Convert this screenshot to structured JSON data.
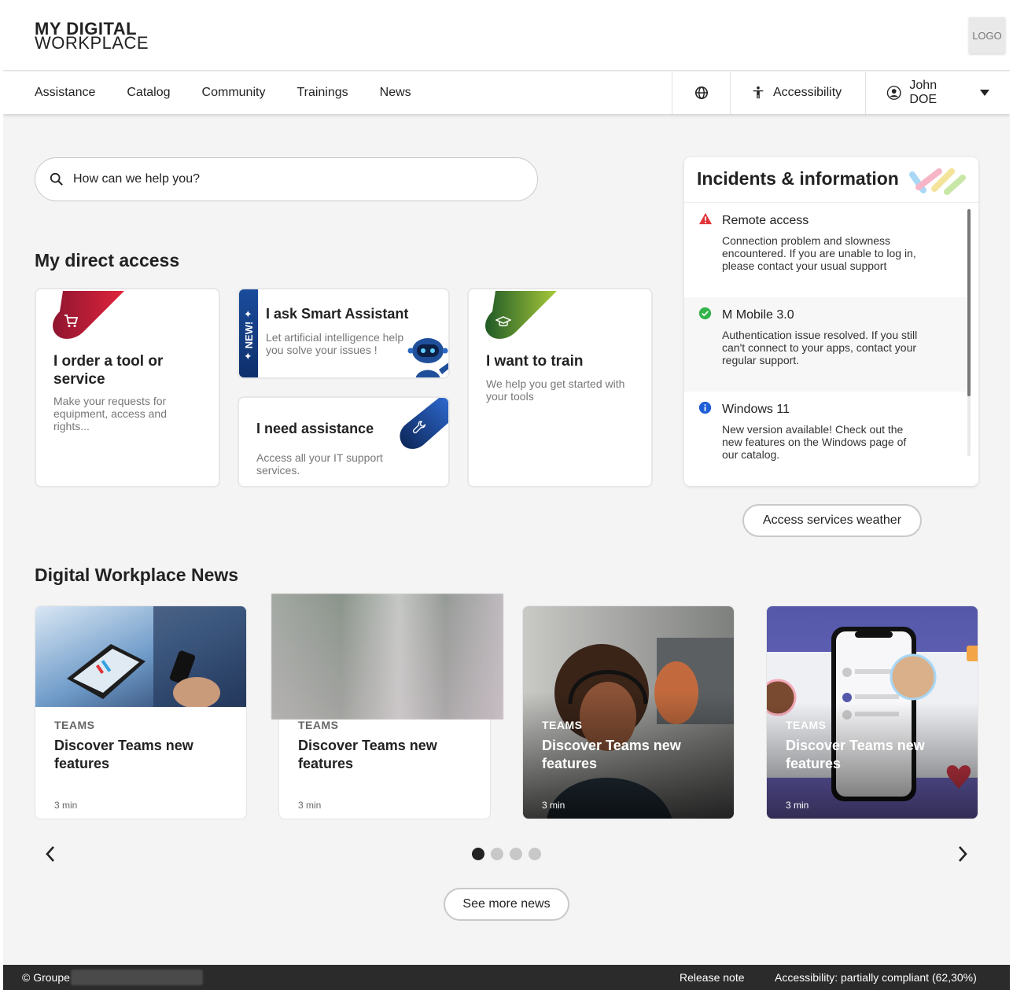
{
  "header": {
    "brand_line1": "MY DIGITAL",
    "brand_line2": "WORKPLACE",
    "logo_label": "LOGO"
  },
  "nav": {
    "items": [
      "Assistance",
      "Catalog",
      "Community",
      "Trainings",
      "News"
    ],
    "globe_icon": "globe-icon",
    "accessibility_label": "Accessibility",
    "user_name": "John DOE"
  },
  "search": {
    "placeholder": "How can we help you?"
  },
  "direct_access": {
    "title": "My direct access",
    "cards": [
      {
        "title": "I order a tool or service",
        "desc": "Make your requests for equipment, access and rights...",
        "icon": "cart-icon",
        "color": "#b01c35"
      },
      {
        "title": "I ask Smart Assistant",
        "desc": "Let artificial intelligence help you solve your issues !",
        "badge": "NEW!",
        "icon": "robot-icon"
      },
      {
        "title": "I need assistance",
        "desc": "Access all your IT support services.",
        "icon": "wrench-icon",
        "color": "#123a7a"
      },
      {
        "title": "I want to train",
        "desc": "We help you get started with your tools",
        "icon": "graduation-cap-icon",
        "color": "#2f6b2a"
      }
    ]
  },
  "incidents": {
    "title": "Incidents & information",
    "items": [
      {
        "title": "Remote access",
        "desc": "Connection problem and slowness encountered. If you are unable to log in, please contact your usual support",
        "status": "warning",
        "color": "#e0343a"
      },
      {
        "title": "M Mobile 3.0",
        "desc": "Authentication issue resolved. If you still can't connect to your apps, contact your regular support.",
        "status": "resolved",
        "color": "#34b34a"
      },
      {
        "title": "Windows 11",
        "desc": "New version available! Check out the new features on the Windows page of our catalog.",
        "status": "info",
        "color": "#1f5fd6"
      }
    ],
    "weather_button": "Access services weather"
  },
  "news": {
    "title": "Digital Workplace News",
    "cards": [
      {
        "category": "TEAMS",
        "title": "Discover Teams new features",
        "duration": "3 min"
      },
      {
        "category": "TEAMS",
        "title": "Discover Teams new features",
        "duration": "3 min"
      },
      {
        "category": "TEAMS",
        "title": "Discover Teams new features",
        "duration": "3 min"
      },
      {
        "category": "TEAMS",
        "title": "Discover Teams new features",
        "duration": "3 min"
      }
    ],
    "more_button": "See more news",
    "pages": 4,
    "active_page": 1
  },
  "footer": {
    "copyright": "© Groupe",
    "release_note": "Release note",
    "accessibility": "Accessibility: partially compliant (62,30%)"
  }
}
